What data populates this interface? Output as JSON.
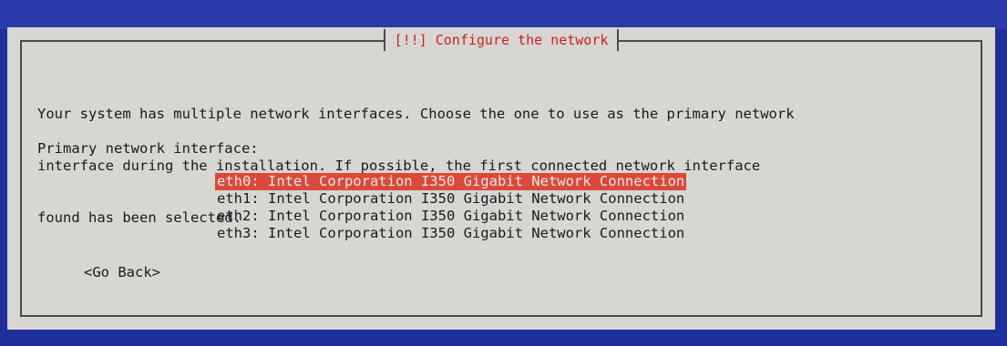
{
  "dialog": {
    "title": "[!!] Configure the network",
    "description_lines": [
      "Your system has multiple network interfaces. Choose the one to use as the primary network",
      "interface during the installation. If possible, the first connected network interface",
      "found has been selected."
    ],
    "prompt": "Primary network interface:",
    "options": [
      {
        "label": "eth0: Intel Corporation I350 Gigabit Network Connection",
        "selected": true
      },
      {
        "label": "eth1: Intel Corporation I350 Gigabit Network Connection",
        "selected": false
      },
      {
        "label": "eth2: Intel Corporation I350 Gigabit Network Connection",
        "selected": false
      },
      {
        "label": "eth3: Intel Corporation I350 Gigabit Network Connection",
        "selected": false
      }
    ],
    "go_back_label": "<Go Back>"
  },
  "colors": {
    "screen_background": "#1f2f9c",
    "dialog_background": "#d7d6d2",
    "title_text": "#c8231f",
    "selected_background": "#d94a3c",
    "selected_text": "#f1e6e3",
    "body_text": "#1a1a1a"
  }
}
